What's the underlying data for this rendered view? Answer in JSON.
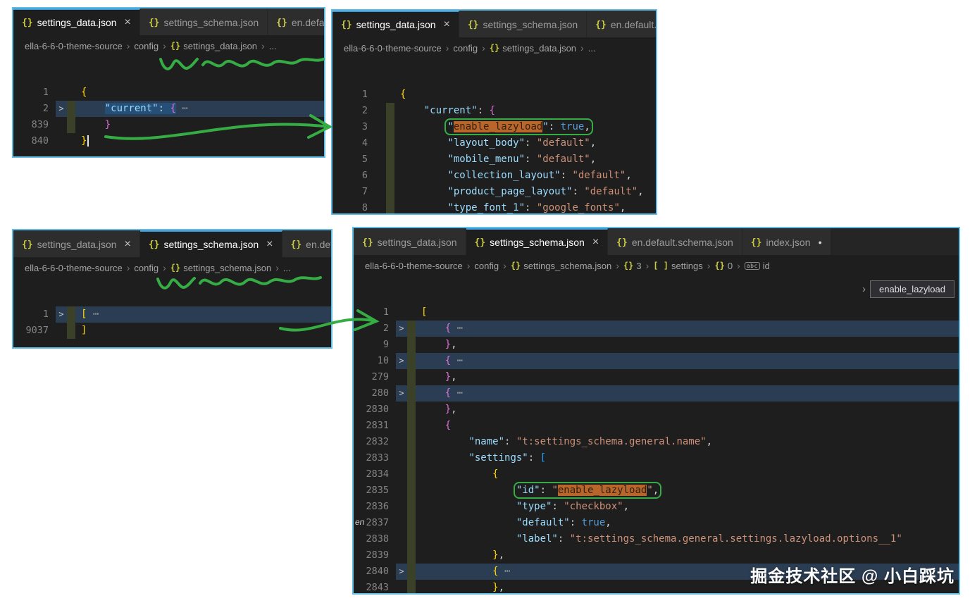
{
  "watermark": "掘金技术社区 @ 小白踩坑",
  "colors": {
    "border": "#5fbde6",
    "annot": "#35ac44",
    "tab_accent": "#3f9bd8",
    "editor_bg": "#1e1e1e",
    "tabbar_bg": "#252526",
    "tab_inactive_bg": "#2d2d2d",
    "tab_inactive_fg": "#9b9b9b",
    "icon_json": "#cbcb41",
    "breadcrumb_fg": "#a5a5a5",
    "ln": "#858585",
    "key": "#9cdcfe",
    "str": "#ce9178",
    "kw": "#569cd6",
    "b1": "#ffd700",
    "b2": "#da70d6",
    "b3": "#179fff",
    "punc": "#d4d4d4",
    "ell": "#9e9e9e",
    "orange_bg": "#b8662c",
    "orange_fg": "#33200a",
    "sel": "#264f78",
    "rowhl": "#2b3d52",
    "git": "#3b4128"
  },
  "panels": {
    "tl": {
      "tabs": [
        {
          "icon": "{}",
          "label": "settings_data.json",
          "active": true,
          "close": true
        },
        {
          "icon": "{}",
          "label": "settings_schema.json"
        },
        {
          "icon": "{}",
          "label": "en.default.schema.json"
        }
      ],
      "breadcrumb": [
        {
          "label": "ella-6-6-0-theme-source"
        },
        {
          "label": "config"
        },
        {
          "icon": "braces",
          "label": "settings_data.json"
        },
        {
          "label": "..."
        }
      ],
      "lines": [
        {
          "num": "1",
          "tokens": [
            {
              "t": "{",
              "c": "b1"
            }
          ]
        },
        {
          "num": "2",
          "fold": true,
          "git": true,
          "hl": true,
          "ind": 4,
          "tokens": [
            {
              "t": "\"current\"",
              "c": "key",
              "m": "sel"
            },
            {
              "t": ": ",
              "c": "punc",
              "m": "sel"
            },
            {
              "t": "{",
              "c": "b2",
              "m": "sel"
            },
            {
              "t": " ⋯",
              "c": "ell"
            }
          ]
        },
        {
          "num": "839",
          "git": true,
          "ind": 4,
          "tokens": [
            {
              "t": "}",
              "c": "b2"
            }
          ]
        },
        {
          "num": "840",
          "cursor": true,
          "tokens": [
            {
              "t": "}",
              "c": "b1"
            }
          ]
        }
      ]
    },
    "tr": {
      "tabs": [
        {
          "icon": "{}",
          "label": "settings_data.json",
          "active": true,
          "close": true
        },
        {
          "icon": "{}",
          "label": "settings_schema.json"
        },
        {
          "icon": "{}",
          "label": "en.default.schema.json"
        }
      ],
      "breadcrumb": [
        {
          "label": "ella-6-6-0-theme-source"
        },
        {
          "label": "config"
        },
        {
          "icon": "braces",
          "label": "settings_data.json"
        },
        {
          "label": "..."
        }
      ],
      "lines": [
        {
          "num": "1",
          "tokens": [
            {
              "t": "{",
              "c": "b1"
            }
          ]
        },
        {
          "num": "2",
          "git": true,
          "ind": 4,
          "tokens": [
            {
              "t": "\"current\"",
              "c": "key"
            },
            {
              "t": ": ",
              "c": "punc"
            },
            {
              "t": "{",
              "c": "b2"
            }
          ]
        },
        {
          "num": "3",
          "git": true,
          "ind": 8,
          "box": true,
          "tokens": [
            {
              "t": "\"",
              "c": "key"
            },
            {
              "t": "enable_lazyload",
              "c": "key",
              "m": "orange"
            },
            {
              "t": "\"",
              "c": "key"
            },
            {
              "t": ": ",
              "c": "punc"
            },
            {
              "t": "true",
              "c": "kw"
            },
            {
              "t": ",",
              "c": "punc"
            }
          ]
        },
        {
          "num": "4",
          "git": true,
          "ind": 8,
          "tokens": [
            {
              "t": "\"layout_body\"",
              "c": "key"
            },
            {
              "t": ": ",
              "c": "punc"
            },
            {
              "t": "\"default\"",
              "c": "str"
            },
            {
              "t": ",",
              "c": "punc"
            }
          ]
        },
        {
          "num": "5",
          "git": true,
          "ind": 8,
          "tokens": [
            {
              "t": "\"mobile_menu\"",
              "c": "key"
            },
            {
              "t": ": ",
              "c": "punc"
            },
            {
              "t": "\"default\"",
              "c": "str"
            },
            {
              "t": ",",
              "c": "punc"
            }
          ]
        },
        {
          "num": "6",
          "git": true,
          "ind": 8,
          "tokens": [
            {
              "t": "\"collection_layout\"",
              "c": "key"
            },
            {
              "t": ": ",
              "c": "punc"
            },
            {
              "t": "\"default\"",
              "c": "str"
            },
            {
              "t": ",",
              "c": "punc"
            }
          ]
        },
        {
          "num": "7",
          "git": true,
          "ind": 8,
          "tokens": [
            {
              "t": "\"product_page_layout\"",
              "c": "key"
            },
            {
              "t": ": ",
              "c": "punc"
            },
            {
              "t": "\"default\"",
              "c": "str"
            },
            {
              "t": ",",
              "c": "punc"
            }
          ]
        },
        {
          "num": "8",
          "git": true,
          "ind": 8,
          "tokens": [
            {
              "t": "\"type_font_1\"",
              "c": "key"
            },
            {
              "t": ": ",
              "c": "punc"
            },
            {
              "t": "\"google_fonts\"",
              "c": "str"
            },
            {
              "t": ",",
              "c": "punc"
            }
          ]
        }
      ]
    },
    "bl": {
      "tabs": [
        {
          "icon": "{}",
          "label": "settings_data.json",
          "close": true
        },
        {
          "icon": "{}",
          "label": "settings_schema.json",
          "active": true,
          "close": true
        },
        {
          "icon": "{}",
          "label": "en.default.schema.json"
        }
      ],
      "breadcrumb": [
        {
          "label": "ella-6-6-0-theme-source"
        },
        {
          "label": "config"
        },
        {
          "icon": "braces",
          "label": "settings_schema.json"
        },
        {
          "label": "..."
        }
      ],
      "lines": [
        {
          "num": "1",
          "fold": true,
          "git": true,
          "hl": true,
          "tokens": [
            {
              "t": "[",
              "c": "b1"
            },
            {
              "t": " ⋯",
              "c": "ell"
            }
          ]
        },
        {
          "num": "9037",
          "git": true,
          "tokens": [
            {
              "t": "]",
              "c": "b1"
            }
          ]
        }
      ]
    },
    "br": {
      "tabs": [
        {
          "icon": "{}",
          "label": "settings_data.json"
        },
        {
          "icon": "{}",
          "label": "settings_schema.json",
          "active": true,
          "close": true
        },
        {
          "icon": "{}",
          "label": "en.default.schema.json"
        },
        {
          "icon": "{}",
          "label": "index.json",
          "dirty": true
        }
      ],
      "breadcrumb": [
        {
          "label": "ella-6-6-0-theme-source"
        },
        {
          "label": "config"
        },
        {
          "icon": "braces",
          "label": "settings_schema.json"
        },
        {
          "icon": "braces",
          "label": "3"
        },
        {
          "icon": "array",
          "label": "settings"
        },
        {
          "icon": "braces",
          "label": "0"
        },
        {
          "icon": "abc",
          "label": "id"
        }
      ],
      "peek": {
        "chevron": "›",
        "value": "enable_lazyload"
      },
      "fragment": "en",
      "lines": [
        {
          "num": "1",
          "tokens": [
            {
              "t": "[",
              "c": "b1"
            }
          ]
        },
        {
          "num": "2",
          "fold": true,
          "git": true,
          "hl": true,
          "ind": 4,
          "tokens": [
            {
              "t": "{",
              "c": "b2"
            },
            {
              "t": " ⋯",
              "c": "ell"
            }
          ]
        },
        {
          "num": "9",
          "git": true,
          "ind": 4,
          "tokens": [
            {
              "t": "}",
              "c": "b2"
            },
            {
              "t": ",",
              "c": "punc"
            }
          ]
        },
        {
          "num": "10",
          "fold": true,
          "git": true,
          "hl": true,
          "ind": 4,
          "tokens": [
            {
              "t": "{",
              "c": "b2"
            },
            {
              "t": " ⋯",
              "c": "ell"
            }
          ]
        },
        {
          "num": "279",
          "git": true,
          "ind": 4,
          "tokens": [
            {
              "t": "}",
              "c": "b2"
            },
            {
              "t": ",",
              "c": "punc"
            }
          ]
        },
        {
          "num": "280",
          "fold": true,
          "git": true,
          "hl": true,
          "ind": 4,
          "tokens": [
            {
              "t": "{",
              "c": "b2"
            },
            {
              "t": " ⋯",
              "c": "ell"
            }
          ]
        },
        {
          "num": "2830",
          "git": true,
          "ind": 4,
          "tokens": [
            {
              "t": "}",
              "c": "b2"
            },
            {
              "t": ",",
              "c": "punc"
            }
          ]
        },
        {
          "num": "2831",
          "git": true,
          "ind": 4,
          "tokens": [
            {
              "t": "{",
              "c": "b2"
            }
          ]
        },
        {
          "num": "2832",
          "git": true,
          "ind": 8,
          "tokens": [
            {
              "t": "\"name\"",
              "c": "key"
            },
            {
              "t": ": ",
              "c": "punc"
            },
            {
              "t": "\"t:settings_schema.general.name\"",
              "c": "str"
            },
            {
              "t": ",",
              "c": "punc"
            }
          ]
        },
        {
          "num": "2833",
          "git": true,
          "ind": 8,
          "tokens": [
            {
              "t": "\"settings\"",
              "c": "key"
            },
            {
              "t": ": ",
              "c": "punc"
            },
            {
              "t": "[",
              "c": "b3"
            }
          ]
        },
        {
          "num": "2834",
          "git": true,
          "ind": 12,
          "tokens": [
            {
              "t": "{",
              "c": "b1"
            }
          ]
        },
        {
          "num": "2835",
          "git": true,
          "ind": 16,
          "box": true,
          "tokens": [
            {
              "t": "\"id\"",
              "c": "key"
            },
            {
              "t": ": ",
              "c": "punc"
            },
            {
              "t": "\"",
              "c": "str"
            },
            {
              "t": "enable_lazyload",
              "c": "str",
              "m": "orange"
            },
            {
              "t": "\"",
              "c": "str"
            },
            {
              "t": ",",
              "c": "punc"
            }
          ]
        },
        {
          "num": "2836",
          "git": true,
          "ind": 16,
          "tokens": [
            {
              "t": "\"type\"",
              "c": "key"
            },
            {
              "t": ": ",
              "c": "punc"
            },
            {
              "t": "\"checkbox\"",
              "c": "str"
            },
            {
              "t": ",",
              "c": "punc"
            }
          ]
        },
        {
          "num": "2837",
          "git": true,
          "ind": 16,
          "tokens": [
            {
              "t": "\"default\"",
              "c": "key"
            },
            {
              "t": ": ",
              "c": "punc"
            },
            {
              "t": "true",
              "c": "kw"
            },
            {
              "t": ",",
              "c": "punc"
            }
          ]
        },
        {
          "num": "2838",
          "git": true,
          "ind": 16,
          "tokens": [
            {
              "t": "\"label\"",
              "c": "key"
            },
            {
              "t": ": ",
              "c": "punc"
            },
            {
              "t": "\"t:settings_schema.general.settings.lazyload.options__1\"",
              "c": "str"
            }
          ]
        },
        {
          "num": "2839",
          "git": true,
          "ind": 12,
          "tokens": [
            {
              "t": "}",
              "c": "b1"
            },
            {
              "t": ",",
              "c": "punc"
            }
          ]
        },
        {
          "num": "2840",
          "fold": true,
          "git": true,
          "hl": true,
          "ind": 12,
          "tokens": [
            {
              "t": "{",
              "c": "b1"
            },
            {
              "t": " ⋯",
              "c": "ell"
            }
          ]
        },
        {
          "num": "2843",
          "git": true,
          "ind": 12,
          "tokens": [
            {
              "t": "}",
              "c": "b1"
            },
            {
              "t": ",",
              "c": "punc"
            }
          ]
        }
      ]
    }
  }
}
